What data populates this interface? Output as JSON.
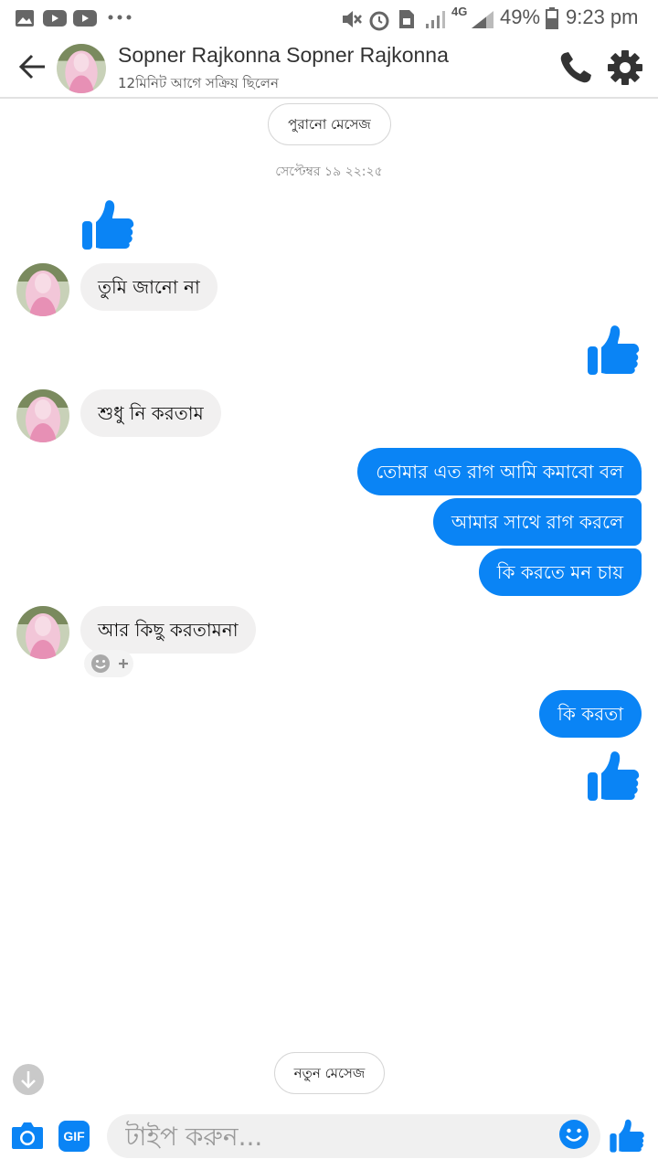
{
  "status_bar": {
    "battery": "49%",
    "time": "9:23 pm",
    "network": "4G"
  },
  "header": {
    "contact_name": "Sopner Rajkonna Sopner Rajkonna",
    "active_status": "12মিনিট আগে সক্রিয় ছিলেন",
    "icons": [
      "back-arrow-icon",
      "phone-icon",
      "gear-icon"
    ]
  },
  "chat": {
    "older_messages_label": "পুরানো মেসেজ",
    "timestamp": "সেপ্টেম্বর ১৯ ২২:২৫",
    "incoming": [
      {
        "text": "তুমি জানো না"
      },
      {
        "text": "শুধু নি করতাম"
      },
      {
        "text": "আর কিছু করতামনা"
      }
    ],
    "outgoing": [
      {
        "text": "তোমার এত রাগ আমি কমাবো বল"
      },
      {
        "text": "আমার সাথে রাগ করলে"
      },
      {
        "text": "কি করতে মন চায়"
      },
      {
        "text": "কি করতা"
      }
    ],
    "new_messages_label": "নতুন মেসেজ"
  },
  "composer": {
    "placeholder": "টাইপ করুন...",
    "gif_label": "GIF"
  },
  "colors": {
    "accent": "#0a84f5",
    "incoming_bubble": "#f1f0f0"
  }
}
